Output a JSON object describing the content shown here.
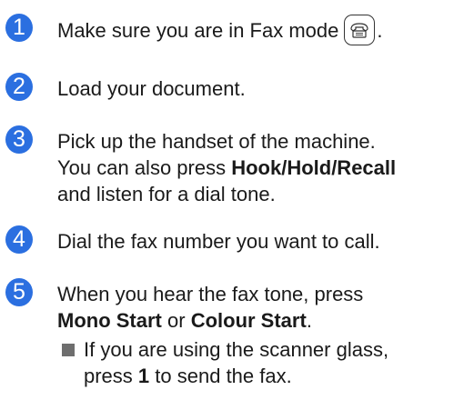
{
  "colors": {
    "accent": "#2b6fe0",
    "bullet": "#6e6e6e"
  },
  "steps": [
    {
      "number": "1",
      "line1": "Make sure you are in Fax mode",
      "icon": "fax-mode-icon",
      "after_icon": "."
    },
    {
      "number": "2",
      "line1": "Load your document."
    },
    {
      "number": "3",
      "line1": "Pick up the handset of the machine.",
      "line2_pre": "You can also press ",
      "line2_bold": "Hook/Hold/Recall",
      "line3": "and listen for a dial tone."
    },
    {
      "number": "4",
      "line1": "Dial the fax number you want to call."
    },
    {
      "number": "5",
      "line1": "When you hear the fax tone, press",
      "line2_bold1": "Mono Start",
      "line2_mid": " or ",
      "line2_bold2": "Colour Start",
      "line2_end": ".",
      "sub": {
        "line1": "If you are using the scanner glass,",
        "line2_pre": "press ",
        "line2_bold": "1",
        "line2_end": " to send the fax."
      }
    }
  ]
}
